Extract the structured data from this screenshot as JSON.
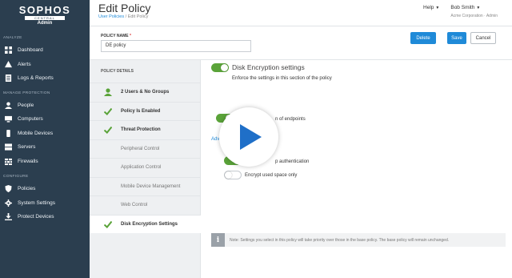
{
  "sidebar": {
    "logo": {
      "brand": "SOPHOS",
      "sub": "CENTRAL",
      "role": "Admin"
    },
    "sections": [
      {
        "heading": "ANALYZE",
        "items": [
          {
            "label": "Dashboard",
            "icon": "dashboard-icon"
          },
          {
            "label": "Alerts",
            "icon": "alert-icon"
          },
          {
            "label": "Logs & Reports",
            "icon": "logs-icon"
          }
        ]
      },
      {
        "heading": "MANAGE PROTECTION",
        "items": [
          {
            "label": "People",
            "icon": "people-icon"
          },
          {
            "label": "Computers",
            "icon": "computer-icon"
          },
          {
            "label": "Mobile Devices",
            "icon": "mobile-icon"
          },
          {
            "label": "Servers",
            "icon": "server-icon"
          },
          {
            "label": "Firewalls",
            "icon": "firewall-icon"
          }
        ]
      },
      {
        "heading": "CONFIGURE",
        "items": [
          {
            "label": "Policies",
            "icon": "shield-icon"
          },
          {
            "label": "System Settings",
            "icon": "gear-icon"
          },
          {
            "label": "Protect Devices",
            "icon": "download-icon"
          }
        ]
      }
    ]
  },
  "header": {
    "title": "Edit Policy",
    "breadcrumb_link": "User Policies",
    "breadcrumb_sep": " / ",
    "breadcrumb_current": "Edit Policy",
    "help": "Help",
    "user_name": "Bob Smith",
    "user_org": "Acme Corporation · Admin"
  },
  "form": {
    "name_label": "POLICY NAME",
    "required_mark": "*",
    "name_value": "DE policy",
    "delete": "Delete",
    "save": "Save",
    "cancel": "Cancel"
  },
  "details": {
    "heading": "POLICY DETAILS",
    "items": [
      {
        "label": "2 Users  &  No Groups",
        "mark": "user-icon",
        "style": "bold"
      },
      {
        "label": "Policy Is Enabled",
        "mark": "check-icon",
        "style": "bold"
      },
      {
        "label": "Threat Protection",
        "mark": "check-icon",
        "style": "bold"
      },
      {
        "label": "Peripheral Control",
        "mark": "",
        "style": "muted"
      },
      {
        "label": "Application Control",
        "mark": "",
        "style": "muted"
      },
      {
        "label": "Mobile Device Management",
        "mark": "",
        "style": "muted"
      },
      {
        "label": "Web Control",
        "mark": "",
        "style": "muted"
      },
      {
        "label": "Disk Encryption Settings",
        "mark": "check-icon",
        "style": "bold active"
      }
    ]
  },
  "content": {
    "section_title": "Disk Encryption settings",
    "section_desc": "Enforce the settings in this section of the policy",
    "row1_text": "n of endpoints",
    "advanced": "Adva",
    "row2_text": "p authentication",
    "row3_text": "Encrypt used space only",
    "note_icon": "i",
    "note": "Note: Settings you select in this policy will take priority over those in the base policy. The base policy will remain unchanged."
  },
  "colors": {
    "sidebar": "#2b3e4f",
    "accent": "#1f8ad8",
    "check": "#5aa339"
  }
}
